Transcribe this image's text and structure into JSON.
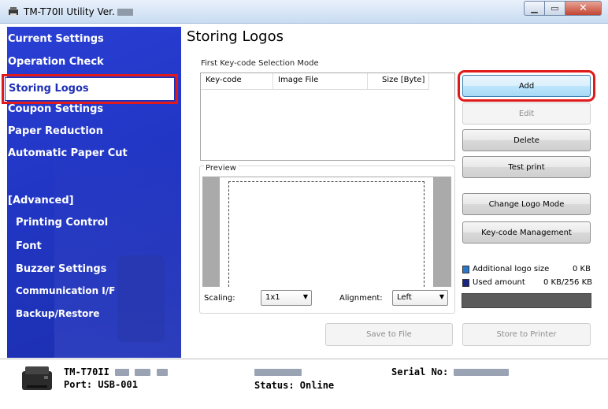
{
  "window": {
    "title": "TM-T70II Utility Ver."
  },
  "sidebar": {
    "items": [
      {
        "label": "Current Settings"
      },
      {
        "label": "Operation Check"
      },
      {
        "label": "Storing Logos",
        "selected": true
      },
      {
        "label": "Coupon Settings"
      },
      {
        "label": "Paper Reduction"
      },
      {
        "label": "Automatic Paper Cut"
      },
      {
        "label": "[Advanced]"
      },
      {
        "label": "Printing Control"
      },
      {
        "label": "Font"
      },
      {
        "label": "Buzzer Settings"
      },
      {
        "label": "Communication I/F"
      },
      {
        "label": "Backup/Restore"
      }
    ]
  },
  "main": {
    "title": "Storing Logos",
    "mode_label": "First Key-code Selection Mode",
    "table": {
      "columns": [
        "Key-code",
        "Image File",
        "Size [Byte]"
      ],
      "rows": []
    },
    "preview_label": "Preview",
    "scaling_label": "Scaling:",
    "scaling_value": "1x1",
    "alignment_label": "Alignment:",
    "alignment_value": "Left",
    "buttons": {
      "add": "Add",
      "edit": "Edit",
      "delete": "Delete",
      "test_print": "Test print",
      "change_logo_mode": "Change Logo Mode",
      "keycode_management": "Key-code Management",
      "save_to_file": "Save to File",
      "store_to_printer": "Store to Printer"
    },
    "legend": {
      "additional_label": "Additional logo size",
      "additional_value": "0 KB",
      "used_label": "Used amount",
      "used_value": "0 KB/256 KB",
      "additional_color": "#2a77c9",
      "used_color": "#1a2580",
      "used_fraction": 0
    }
  },
  "status": {
    "model": "TM-T70II",
    "port": "Port: USB-001",
    "status_text": "Status: Online",
    "serial_label": "Serial No:"
  },
  "colors": {
    "sidebar": "#2136c4",
    "highlight": "#e01a1a"
  }
}
